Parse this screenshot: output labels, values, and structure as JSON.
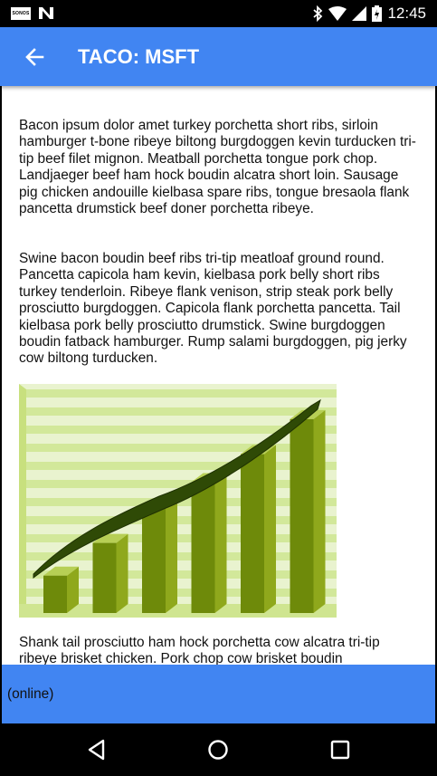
{
  "status_bar": {
    "time": "12:45",
    "left_icons": [
      "sonos-icon",
      "n-notification-icon"
    ],
    "right_icons": [
      "bluetooth-icon",
      "wifi-icon",
      "signal-icon",
      "battery-charging-icon"
    ],
    "sonos_text": "SONOS"
  },
  "app_bar": {
    "title": "TACO: MSFT",
    "back_icon": "arrow-back-icon"
  },
  "article": {
    "paragraphs": [
      "Bacon ipsum dolor amet turkey porchetta short ribs, sirloin hamburger t-bone ribeye biltong burgdoggen kevin turducken tri-tip beef filet mignon. Meatball porchetta tongue pork chop. Landjaeger beef ham hock boudin alcatra short loin. Sausage pig chicken andouille kielbasa spare ribs, tongue bresaola flank pancetta drumstick beef doner porchetta ribeye.",
      "Swine bacon boudin beef ribs tri-tip meatloaf ground round. Pancetta capicola ham kevin, kielbasa pork belly short ribs turkey tenderloin. Ribeye flank venison, strip steak pork belly prosciutto burgdoggen. Capicola flank porchetta pancetta. Tail kielbasa pork belly prosciutto drumstick. Swine burgdoggen boudin fatback hamburger. Rump salami burgdoggen, pig jerky cow biltong turducken.",
      "Shank tail prosciutto ham hock porchetta cow alcatra tri-tip ribeye brisket chicken. Pork chop cow brisket boudin"
    ],
    "image": {
      "icon": "growth-bar-chart-illustration",
      "bar_levels": [
        0.16,
        0.3,
        0.45,
        0.56,
        0.68,
        0.83
      ]
    }
  },
  "bottom_bar": {
    "status": "(online)"
  },
  "nav_bar": {
    "buttons": [
      "back-triangle-icon",
      "home-circle-icon",
      "recents-square-icon"
    ]
  },
  "colors": {
    "app_bar": "#4185f2",
    "chart_bar": "#6e8a0a",
    "chart_stripe": "#d2e89a",
    "chart_line": "#2f4a06"
  }
}
